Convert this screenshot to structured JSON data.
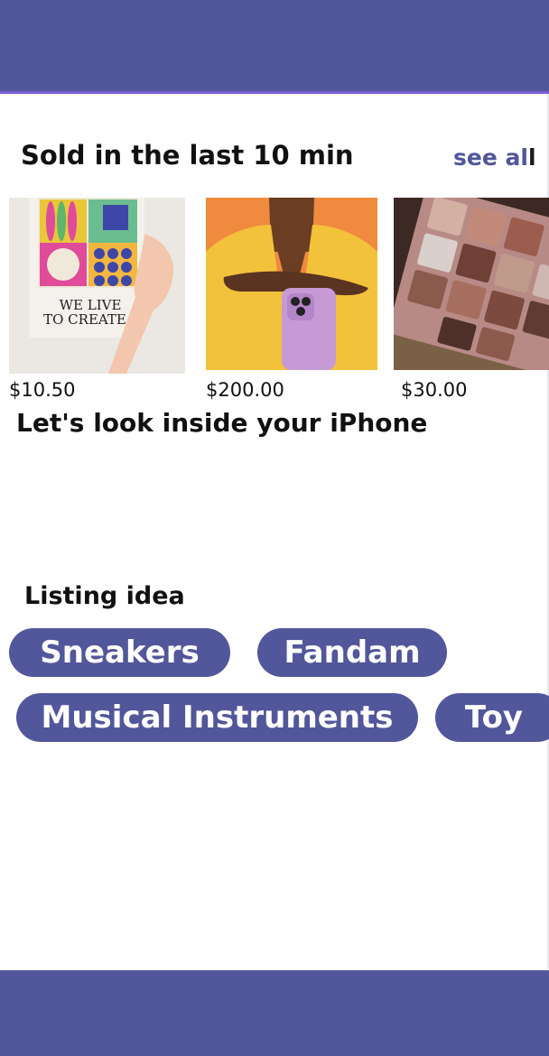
{
  "sold_section": {
    "title": "Sold in the last 10 min",
    "see_all_main": "see al",
    "see_all_end": "l"
  },
  "products": [
    {
      "price": "$10.50",
      "poster_text_line1": "WE LIVE",
      "poster_text_line2": "TO CREATE"
    },
    {
      "price": "$200.00"
    },
    {
      "price": "$30.00"
    }
  ],
  "iphone_section": {
    "title": "Let's look inside your iPhone"
  },
  "listing_section": {
    "title": "Listing idea",
    "chips": [
      "Sneakers",
      "Fandam",
      "Musical Instruments",
      "Toy"
    ]
  },
  "colors": {
    "brand": "#52569a",
    "accent_border": "#7b5cd6"
  }
}
